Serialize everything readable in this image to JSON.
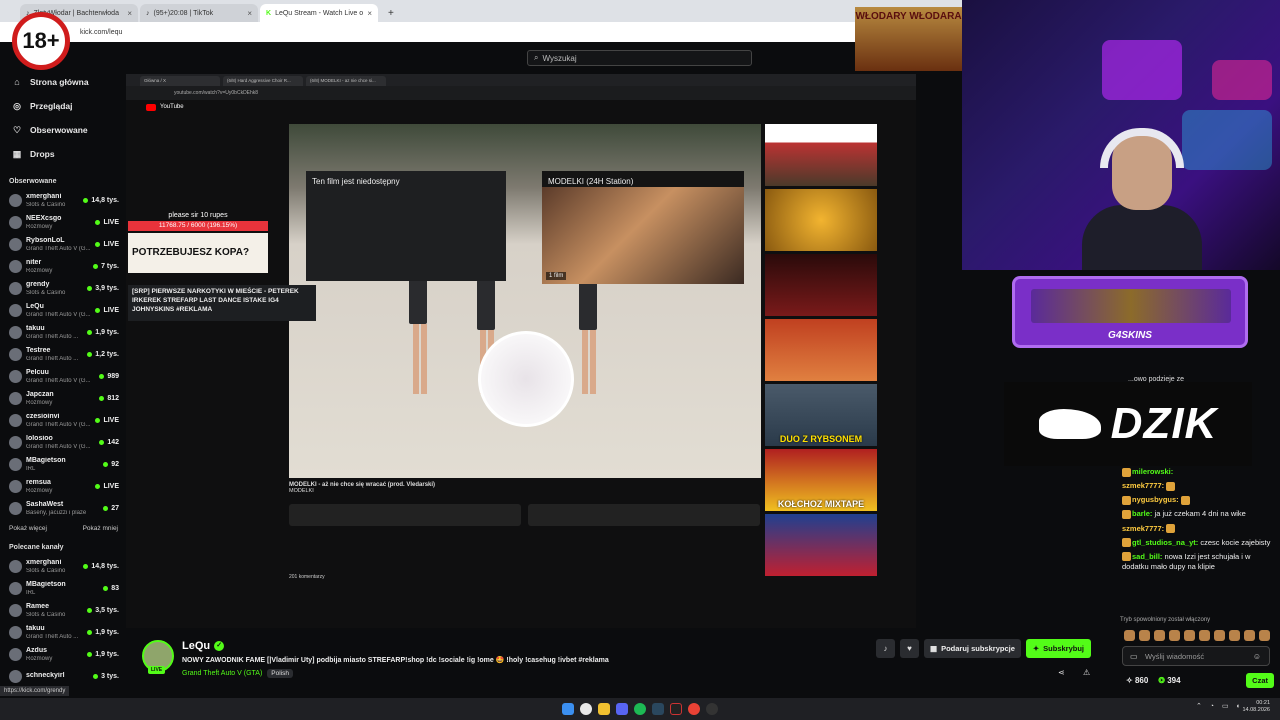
{
  "browser": {
    "tabs": [
      {
        "label": "ZłotyWłodar | Bachterwłoda"
      },
      {
        "label": "(95+)20:08 | TikTok"
      },
      {
        "label": "LeQu Stream - Watch Live o"
      }
    ],
    "new_tab": "+",
    "url": "kick.com/lequ",
    "status_url": "https://kick.com/grendy"
  },
  "age_badge": "18+",
  "search": {
    "placeholder": "Wyszukaj"
  },
  "nav": [
    {
      "label": "Strona główna",
      "icon": "home-icon"
    },
    {
      "label": "Przeglądaj",
      "icon": "compass-icon"
    },
    {
      "label": "Obserwowane",
      "icon": "heart-icon"
    },
    {
      "label": "Drops",
      "icon": "gift-icon"
    }
  ],
  "followed": {
    "heading": "Obserwowane",
    "channels": [
      {
        "name": "xmerghani",
        "category": "Slots & Casino",
        "viewers": "14,8 tys."
      },
      {
        "name": "NEEXcsgo",
        "category": "Rozmowy",
        "viewers": "LIVE"
      },
      {
        "name": "RybsonLoL",
        "category": "Grand Theft Auto V (G...",
        "viewers": "LIVE"
      },
      {
        "name": "niter",
        "category": "Rozmowy",
        "viewers": "7 tys."
      },
      {
        "name": "grendy",
        "category": "Slots & Casino",
        "viewers": "3,9 tys."
      },
      {
        "name": "LeQu",
        "category": "Grand Theft Auto V (G...",
        "viewers": "LIVE"
      },
      {
        "name": "takuu",
        "category": "Grand Theft Auto ...",
        "viewers": "1,9 tys."
      },
      {
        "name": "Testree",
        "category": "Grand Theft Auto ...",
        "viewers": "1,2 tys."
      },
      {
        "name": "Pelcuu",
        "category": "Grand Theft Auto V (G...",
        "viewers": "989"
      },
      {
        "name": "Japczan",
        "category": "Rozmowy",
        "viewers": "812"
      },
      {
        "name": "czesioinvi",
        "category": "Grand Theft Auto V (G...",
        "viewers": "LIVE"
      },
      {
        "name": "lolosioo",
        "category": "Grand Theft Auto V (G...",
        "viewers": "142"
      },
      {
        "name": "MBagietson",
        "category": "IRL",
        "viewers": "92"
      },
      {
        "name": "remsua",
        "category": "Rozmowy",
        "viewers": "LIVE"
      },
      {
        "name": "SashaWest",
        "category": "Baseny, jacuzzi i plaże",
        "viewers": "27"
      }
    ],
    "show_more": "Pokaż więcej",
    "show_less": "Pokaż mniej"
  },
  "recommended": {
    "heading": "Polecane kanały",
    "channels": [
      {
        "name": "xmerghani",
        "category": "Slots & Casino",
        "viewers": "14,8 tys."
      },
      {
        "name": "MBagietson",
        "category": "IRL",
        "viewers": "83"
      },
      {
        "name": "Ramee",
        "category": "Slots & Casino",
        "viewers": "3,5 tys."
      },
      {
        "name": "takuu",
        "category": "Grand Theft Auto ...",
        "viewers": "1,9 tys."
      },
      {
        "name": "Azdus",
        "category": "Rozmowy",
        "viewers": "1,9 tys."
      },
      {
        "name": "schneckyirl",
        "category": "",
        "viewers": "3 tys."
      }
    ]
  },
  "stream_overlay": {
    "inner_tabs": [
      "Główna / X",
      "(6/8) Hard Aggressive Choir R...",
      "(6/8) MODELKI - az nie chce si..."
    ],
    "inner_url": "youtube.com/watch?v=Uy0bCkDEhk8",
    "yt_label": "YouTube",
    "popup_unavailable": "Ten film jest niedostępny",
    "popup_title": "MODELKI (24H Station)",
    "popup_count": "1 film",
    "video_title": "MODELKI - aż nie chce się wracać (prod. Vledarski)",
    "video_channel": "MODELKI",
    "comments": "201 komentarzy",
    "thumb_captions": [
      "",
      "",
      "",
      "",
      "DUO Z RYBSONEM",
      "KOŁCHOZ MIXTAPE",
      ""
    ],
    "donation_top": "please sir 10 rupes",
    "donation_progress": "11768.75 / 6000 (196.15%)",
    "donation_ad": "POTRZEBUJESZ KOPA?",
    "tooltip": "[SRP] PIERWSZE NARKOTYKI W MIEŚCIE - PETEREK IRKEREK STREFARP LAST DANCE ISTAKE IG4 JOHNYSKINS #REKLAMA",
    "poster": "WŁODARY WŁODARA",
    "g4_brand": "G4SKINS",
    "dzik": "DZIK"
  },
  "chat": {
    "ticker": "...owo podzieje ze",
    "messages": [
      {
        "user": "milerowski:",
        "text": ""
      },
      {
        "user": "szmek7777:",
        "text": ""
      },
      {
        "user": "nygusbygus:",
        "text": ""
      },
      {
        "user": "barle:",
        "text": "ja już czekam 4 dni na wike"
      },
      {
        "user": "szmek7777:",
        "text": ""
      },
      {
        "user": "gtl_studios_na_yt:",
        "text": "czesc kocie zajebisty"
      },
      {
        "user": "sad_bill:",
        "text": "nowa Izzi jest schujała i w dodatku mało dupy na klipie"
      }
    ],
    "mode_hint": "Tryb spowolniony został włączony",
    "input_placeholder": "Wyślij wiadomość",
    "points_a": "860",
    "points_b": "394",
    "send_label": "Czat"
  },
  "channel": {
    "name": "LeQu",
    "live_badge": "LIVE",
    "title": "NOWY ZAWODNIK FAME [|Vladimir Uty] podbija miasto STREFARP!shop !dc !sociale !ig !ome 🤩 !holy !casehug !ivbet  #reklama",
    "category": "Grand Theft Auto V (GTA)",
    "language": "Polish",
    "gift_label": "Podaruj subskrypcje",
    "subscribe_label": "Subskrybuj"
  },
  "taskbar": {
    "time": "00:21",
    "date": "14.08.2026"
  },
  "colors": {
    "accent": "#53fc18",
    "donation": "#e8333b"
  }
}
